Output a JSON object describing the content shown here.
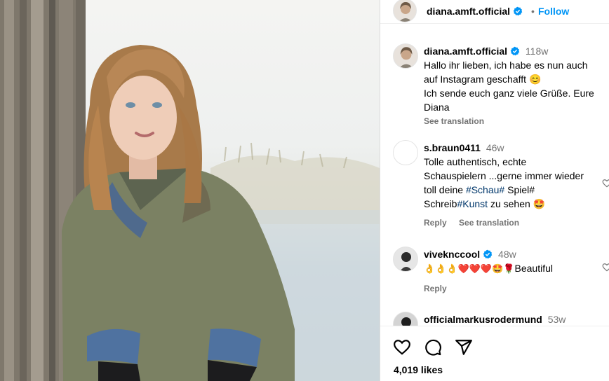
{
  "post": {
    "author": "diana.amft.official",
    "follow_label": "Follow",
    "separator": "•"
  },
  "comments": [
    {
      "user": "diana.amft.official",
      "verified": true,
      "time": "118w",
      "text_line1": "Hallo ihr lieben, ich habe es nun auch",
      "text_line2": "auf Instagram geschafft 😊",
      "text_line3": "Ich sende euch ganz viele Grüße. Eure",
      "text_line4": "Diana",
      "see_translation": "See translation"
    },
    {
      "user": "s.braun0411",
      "time": "46w",
      "text_line1": "Tolle authentisch, echte",
      "text_line2": "Schauspielern ...gerne immer wieder",
      "text_line3a": "toll deine ",
      "hashtag1": "#Schau#",
      "text_line3b": " Spiel#",
      "text_line4a": "Schreib",
      "hashtag2": "#Kunst",
      "text_line4b": " zu sehen 🤩",
      "reply": "Reply",
      "see_translation": "See translation"
    },
    {
      "user": "viveknccool",
      "verified": true,
      "time": "48w",
      "emoji_text": "👌👌👌❤️❤️❤️🤩🌹",
      "text_tail": "Beautiful",
      "reply": "Reply"
    },
    {
      "user": "officialmarkusrodermund",
      "time": "53w"
    }
  ],
  "likes": "4,019 likes",
  "icons": {
    "like": "heart-icon",
    "comment": "comment-icon",
    "share": "share-icon",
    "verified": "verified-badge-icon"
  },
  "colors": {
    "link": "#0095f6",
    "hashtag": "#00376b",
    "muted": "#737373",
    "verified": "#0095f6"
  }
}
